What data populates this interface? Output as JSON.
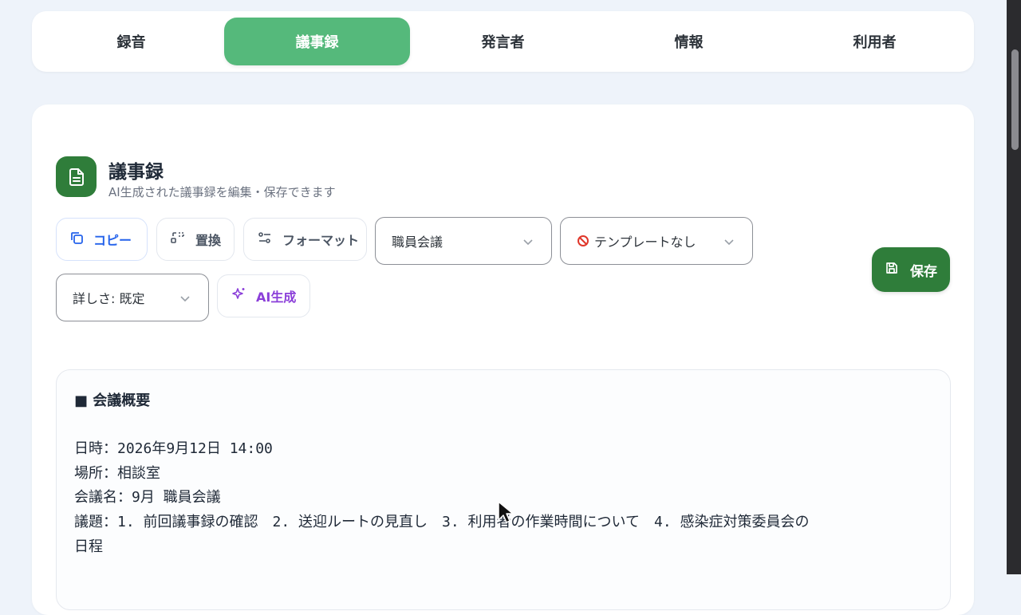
{
  "tabs": [
    {
      "label": "録音"
    },
    {
      "label": "議事録",
      "active": true
    },
    {
      "label": "発言者"
    },
    {
      "label": "情報"
    },
    {
      "label": "利用者"
    }
  ],
  "header": {
    "icon": "document-icon",
    "title": "議事録",
    "subtitle": "AI生成された議事録を編集・保存できます"
  },
  "toolbar": {
    "copy_label": "コピー",
    "replace_label": "置換",
    "format_label": "フォーマット",
    "meeting_type_value": "職員会議",
    "template_value": "テンプレートなし",
    "detail_value": "詳しさ: 既定",
    "ai_generate_label": "AI生成",
    "save_label": "保存"
  },
  "colors": {
    "accent_green": "#55b97b",
    "save_green": "#2f7d3a",
    "copy_blue": "#2563eb",
    "ai_purple": "#8b3fd9"
  },
  "document": {
    "heading": "■ 会議概要",
    "lines": [
      "日時：2026年9月12日 14:00",
      "場所：相談室",
      "会議名：9月 職員会議",
      "議題：1. 前回議事録の確認　2. 送迎ルートの見直し　3. 利用者の作業時間について　4. 感染症対策委員会の",
      "日程"
    ]
  }
}
